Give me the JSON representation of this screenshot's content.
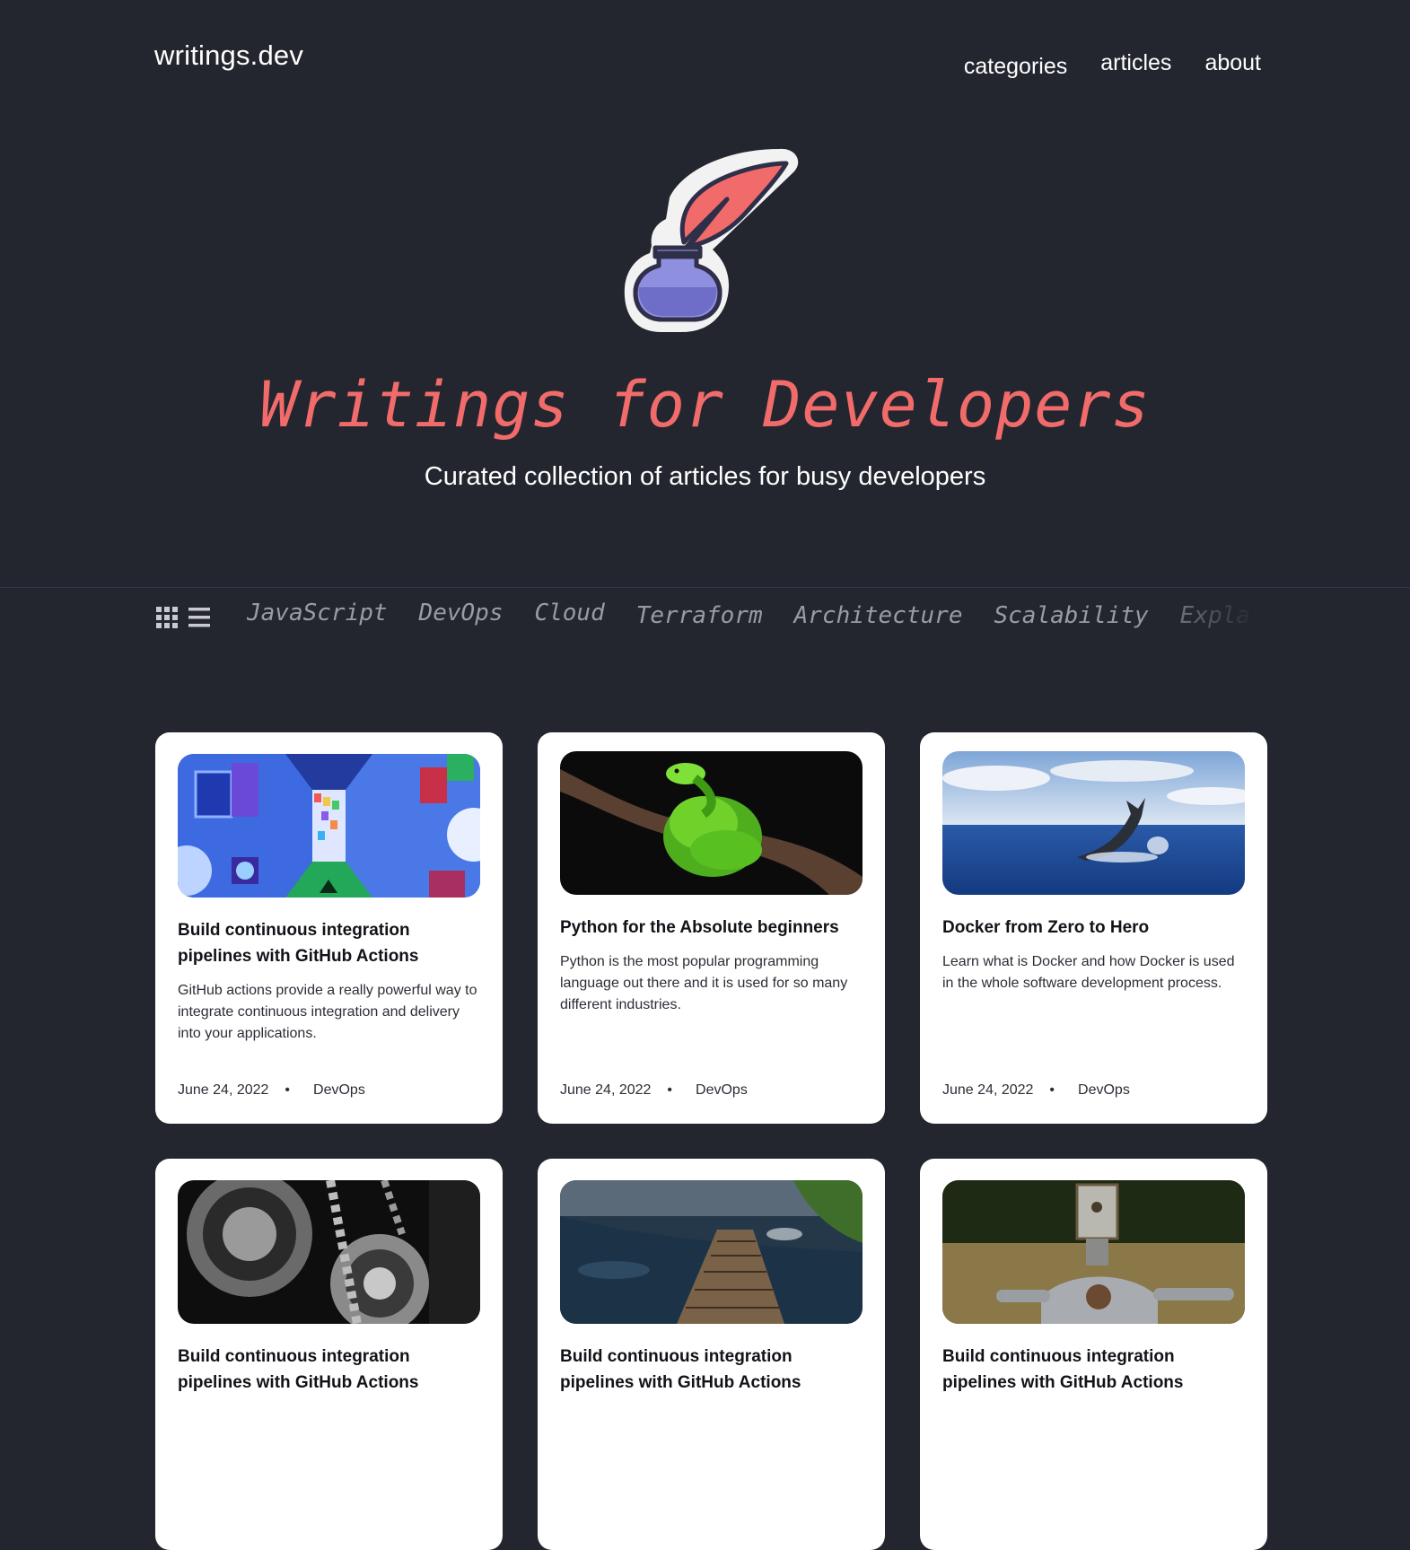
{
  "header": {
    "logo": "writings.dev",
    "nav": [
      "categories",
      "articles",
      "about"
    ]
  },
  "hero": {
    "title": "Writings for Developers",
    "subtitle": "Curated collection of articles for busy developers"
  },
  "categories": [
    "JavaScript",
    "DevOps",
    "Cloud",
    "Terraform",
    "Architecture",
    "Scalability",
    "Explainers"
  ],
  "colors": {
    "background": "#23262f",
    "accent": "#f26b6b",
    "card": "#ffffff"
  },
  "cards": [
    {
      "image": "abstract-colorful-corridor",
      "title": "Build continuous integration pipelines with GitHub Actions",
      "excerpt": "GitHub actions provide a really powerful way to integrate continuous integration and delivery into your applications.",
      "date": "June 24, 2022",
      "category": "DevOps"
    },
    {
      "image": "green-snake-on-branch",
      "title": "Python for the Absolute beginners",
      "excerpt": "Python is the most popular programming language out there and it is used for so many different industries.",
      "date": "June 24, 2022",
      "category": "DevOps"
    },
    {
      "image": "whale-tail-in-ocean",
      "title": "Docker from Zero to Hero",
      "excerpt": "Learn what is Docker and  how Docker is used in the whole software development process.",
      "date": "June 24, 2022",
      "category": "DevOps"
    },
    {
      "image": "black-white-gears",
      "title": "Build continuous integration pipelines with GitHub Actions"
    },
    {
      "image": "wooden-bridge-over-stream",
      "title": "Build continuous integration pipelines with GitHub Actions"
    },
    {
      "image": "metal-robot-in-field",
      "title": "Build continuous integration pipelines with GitHub Actions"
    }
  ]
}
